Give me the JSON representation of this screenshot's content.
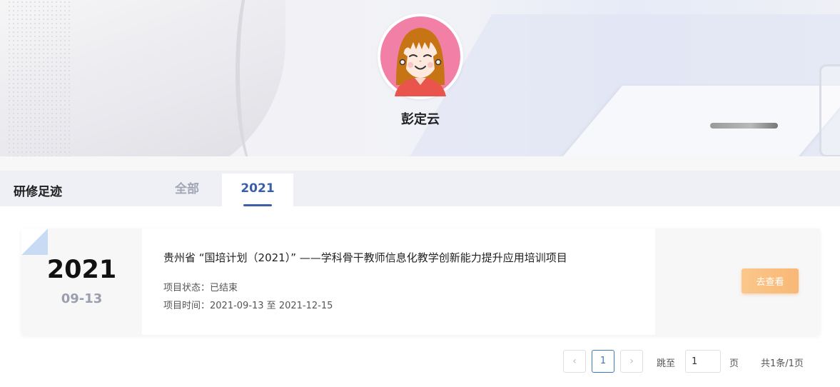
{
  "profile": {
    "name": "彭定云",
    "avatar_icon": "girl-avatar-icon"
  },
  "section": {
    "title": "研修足迹"
  },
  "tabs": [
    {
      "label": "全部",
      "active": false
    },
    {
      "label": "2021",
      "active": true
    }
  ],
  "records": [
    {
      "year": "2021",
      "month_day": "09-13",
      "title": "贵州省 “国培计划（2021）” ——学科骨干教师信息化教学创新能力提升应用培训项目",
      "status": "项目状态：已结束",
      "time": "项目时间：2021-09-13 至 2021-12-15",
      "action_label": "去查看"
    }
  ],
  "pagination": {
    "prev_icon": "chevron-left-icon",
    "next_icon": "chevron-right-icon",
    "current_page": "1",
    "jump_label": "跳至",
    "jump_value": "1",
    "page_unit": "页",
    "total": "共1条/1页"
  },
  "colors": {
    "accent": "#3a5fa9",
    "button": "#f8b876",
    "page_active": "#3a7bbf"
  }
}
